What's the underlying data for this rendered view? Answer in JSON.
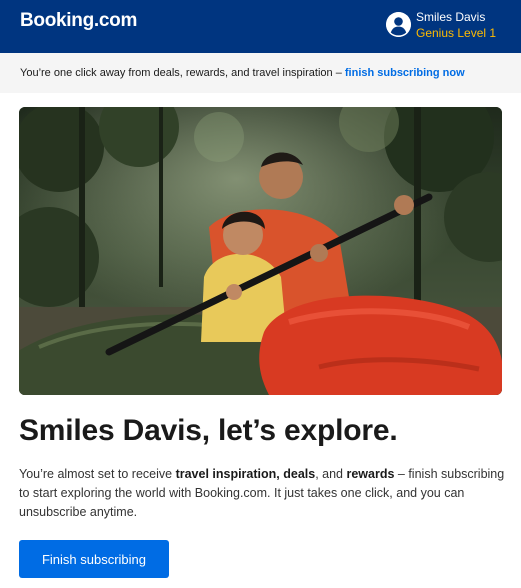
{
  "header": {
    "logo_text": "Booking.com",
    "account": {
      "name": "Smiles Davis",
      "level": "Genius Level 1",
      "icon": "user-avatar-icon"
    }
  },
  "banner": {
    "text": "You’re one click away from deals, rewards, and travel inspiration – ",
    "link": "finish subscribing now"
  },
  "hero": {
    "image_alt": "kayaking-family-photo"
  },
  "main": {
    "headline": "Smiles Davis, let’s explore.",
    "body": {
      "part1": "You’re almost set to receive ",
      "bold1": "travel inspiration, deals",
      "part2": ", and ",
      "bold2": "rewards",
      "part3": " – finish subscribing to start exploring the world with Booking.com. It just takes one click, and you can unsubscribe anytime."
    },
    "cta_label": "Finish subscribing"
  },
  "colors": {
    "brand_blue": "#003580",
    "link_blue": "#006ce4",
    "genius_yellow": "#febb02",
    "banner_bg": "#f5f5f5"
  }
}
